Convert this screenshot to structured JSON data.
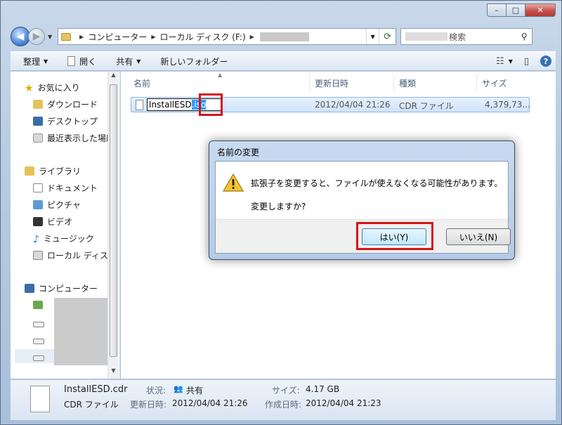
{
  "window": {
    "minimize_icon": "minimize-icon",
    "maximize_icon": "maximize-icon",
    "close_icon": "close-icon"
  },
  "address": {
    "crumbs": [
      "コンピューター",
      "ローカル ディスク (F:)"
    ],
    "search_suffix": "検索"
  },
  "toolbar": {
    "organize": "整理",
    "open": "開く",
    "share": "共有",
    "new_folder": "新しいフォルダー"
  },
  "navpane": {
    "favorites": "お気に入り",
    "downloads": "ダウンロード",
    "desktop": "デスクトップ",
    "recent": "最近表示した場所",
    "libraries": "ライブラリ",
    "documents": "ドキュメント",
    "pictures": "ピクチャ",
    "videos": "ビデオ",
    "music": "ミュージック",
    "local_disk": "ローカル ディスク",
    "computer": "コンピューター"
  },
  "columns": {
    "name": "名前",
    "date": "更新日時",
    "type": "種類",
    "size": "サイズ"
  },
  "file": {
    "rename_base": "InstallESD",
    "rename_ext": ".iso",
    "date": "2012/04/04 21:26",
    "type": "CDR ファイル",
    "size": "4,379,73..."
  },
  "dialog": {
    "title": "名前の変更",
    "message": "拡張子を変更すると、ファイルが使えなくなる可能性があります。",
    "question": "変更しますか?",
    "yes": "はい(Y)",
    "no": "いいえ(N)"
  },
  "details": {
    "filename": "InstallESD.cdr",
    "filetype": "CDR ファイル",
    "status_label": "状況:",
    "status_value": "共有",
    "modified_label": "更新日時:",
    "modified_value": "2012/04/04 21:26",
    "size_label": "サイズ:",
    "size_value": "4.17 GB",
    "created_label": "作成日時:",
    "created_value": "2012/04/04 21:23"
  },
  "colors": {
    "highlight": "#d5141a",
    "selection": "#3399ff"
  }
}
